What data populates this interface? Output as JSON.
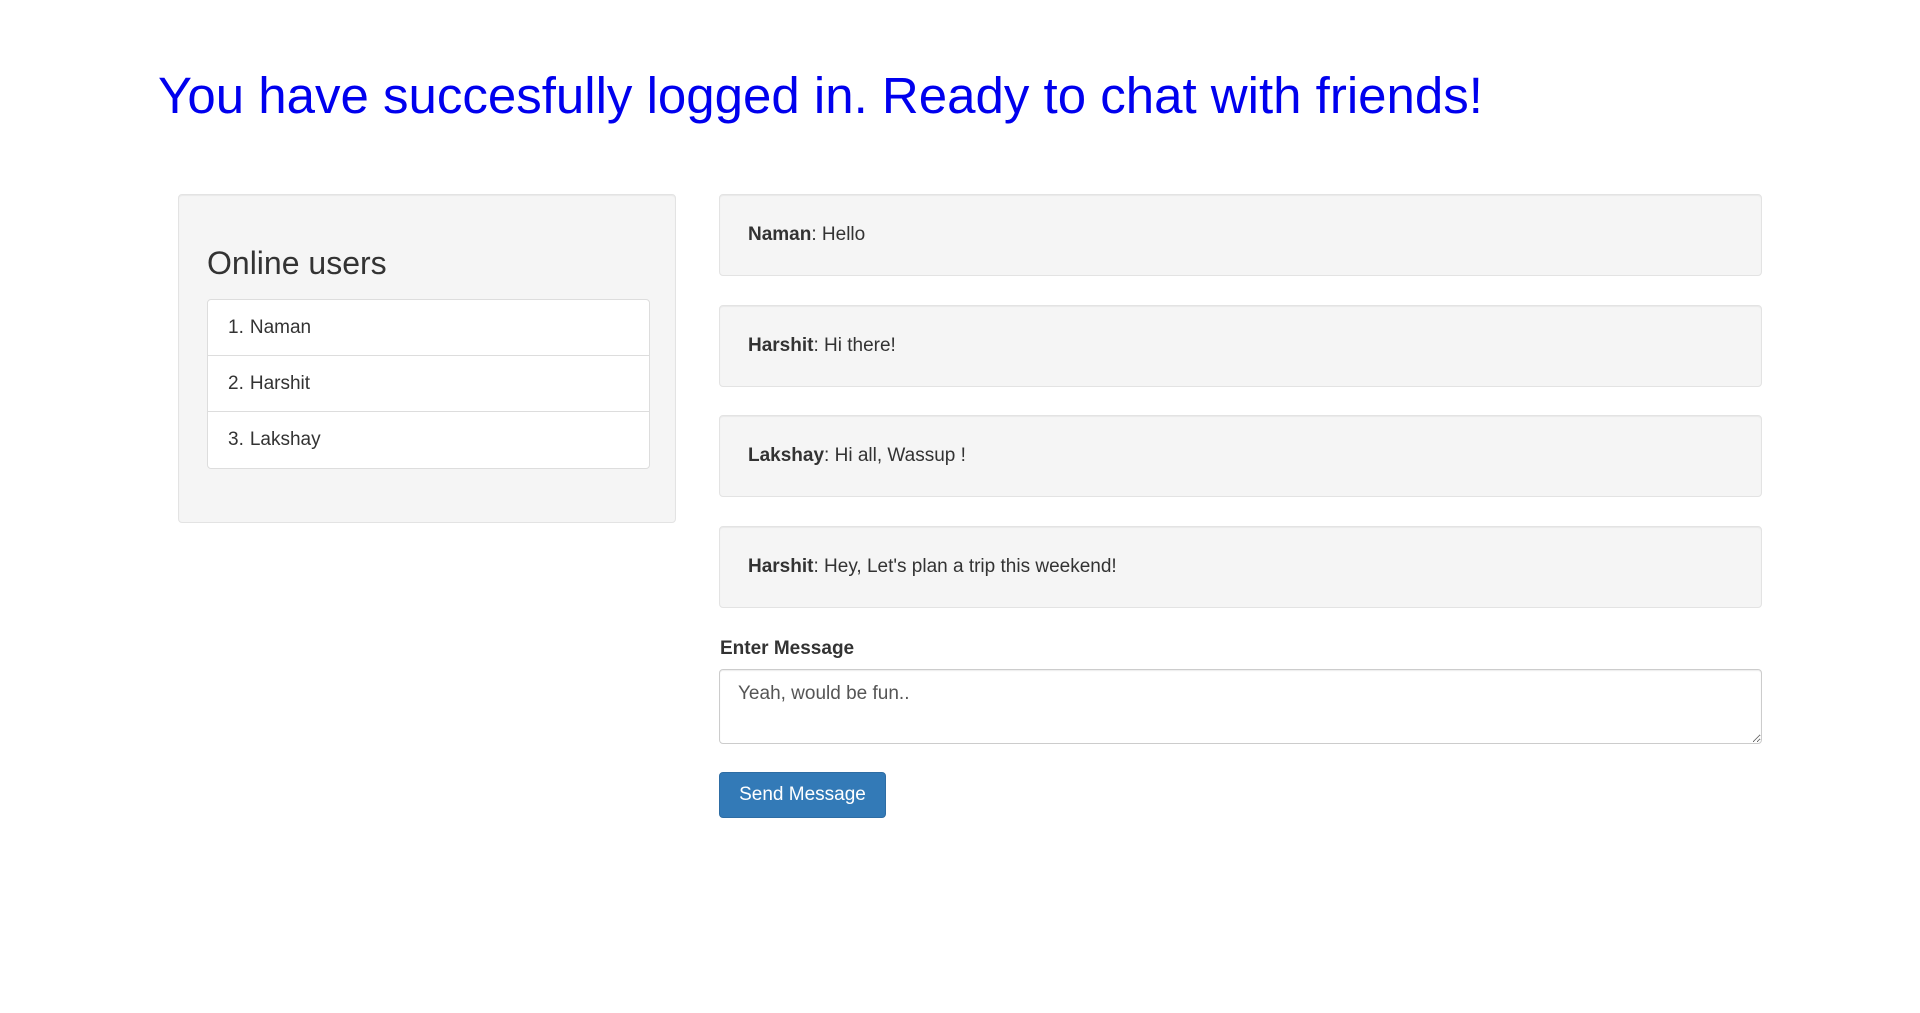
{
  "page": {
    "title": "You have succesfully logged in. Ready to chat with friends!",
    "title_color": "#0000ee"
  },
  "online_users": {
    "heading": "Online users",
    "items": [
      {
        "index": "1.",
        "name": "Naman"
      },
      {
        "index": "2.",
        "name": "Harshit"
      },
      {
        "index": "3.",
        "name": "Lakshay"
      }
    ]
  },
  "messages": [
    {
      "author": "Naman",
      "text": ": Hello"
    },
    {
      "author": "Harshit",
      "text": ": Hi there!"
    },
    {
      "author": "Lakshay",
      "text": ": Hi all, Wassup !"
    },
    {
      "author": "Harshit",
      "text": ": Hey, Let's plan a trip this weekend!"
    }
  ],
  "composer": {
    "label": "Enter Message",
    "value": "Yeah, would be fun..",
    "send_label": "Send Message",
    "send_color": "#337ab7"
  }
}
